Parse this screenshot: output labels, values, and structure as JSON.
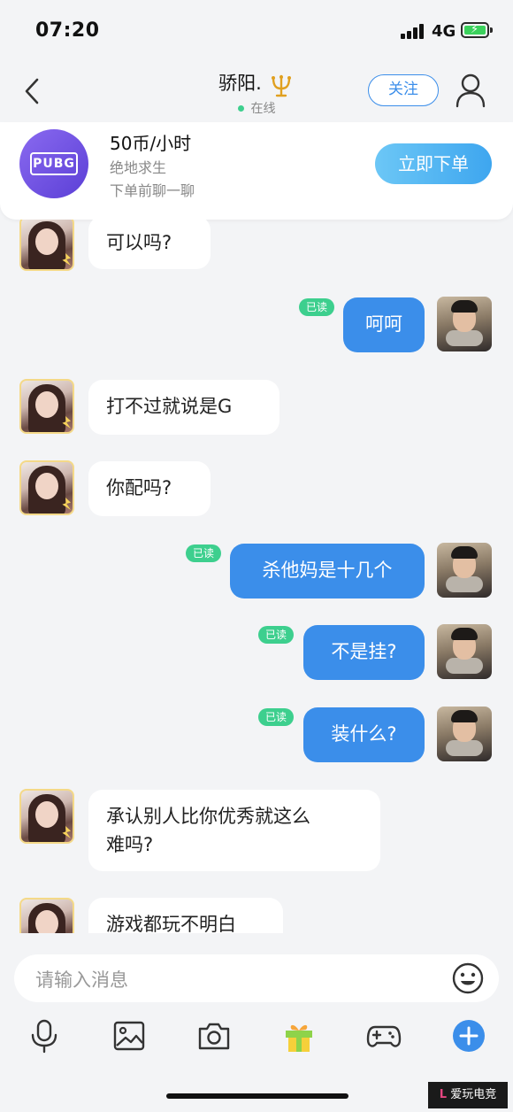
{
  "status_bar": {
    "time": "07:20",
    "network": "4G"
  },
  "header": {
    "name": "骄阳.",
    "status": "在线",
    "follow_label": "关注"
  },
  "order": {
    "logo_text": "PUBG",
    "price": "50币/小时",
    "game": "绝地求生",
    "hint": "下单前聊一聊",
    "button": "立即下单"
  },
  "messages": [
    {
      "side": "in",
      "text": "可以吗?"
    },
    {
      "side": "out",
      "text": "呵呵",
      "read": "已读"
    },
    {
      "side": "in",
      "text": "打不过就说是G"
    },
    {
      "side": "in",
      "text": "你配吗?"
    },
    {
      "side": "out",
      "text": "杀他妈是十几个",
      "read": "已读"
    },
    {
      "side": "out",
      "text": "不是挂?",
      "read": "已读"
    },
    {
      "side": "out",
      "text": "装什么?",
      "read": "已读"
    },
    {
      "side": "in",
      "text": "承认别人比你优秀就这么\n难吗?"
    },
    {
      "side": "in",
      "text": "游戏都玩不明白"
    }
  ],
  "input": {
    "placeholder": "请输入消息"
  },
  "toolbar": [
    "microphone-icon",
    "image-icon",
    "camera-icon",
    "gift-icon",
    "gamepad-icon",
    "plus-icon"
  ],
  "watermark": {
    "text": "爱玩电竞"
  },
  "colors": {
    "accent": "#3b8eea",
    "online": "#3dcf8e",
    "background": "#f3f4f6"
  }
}
